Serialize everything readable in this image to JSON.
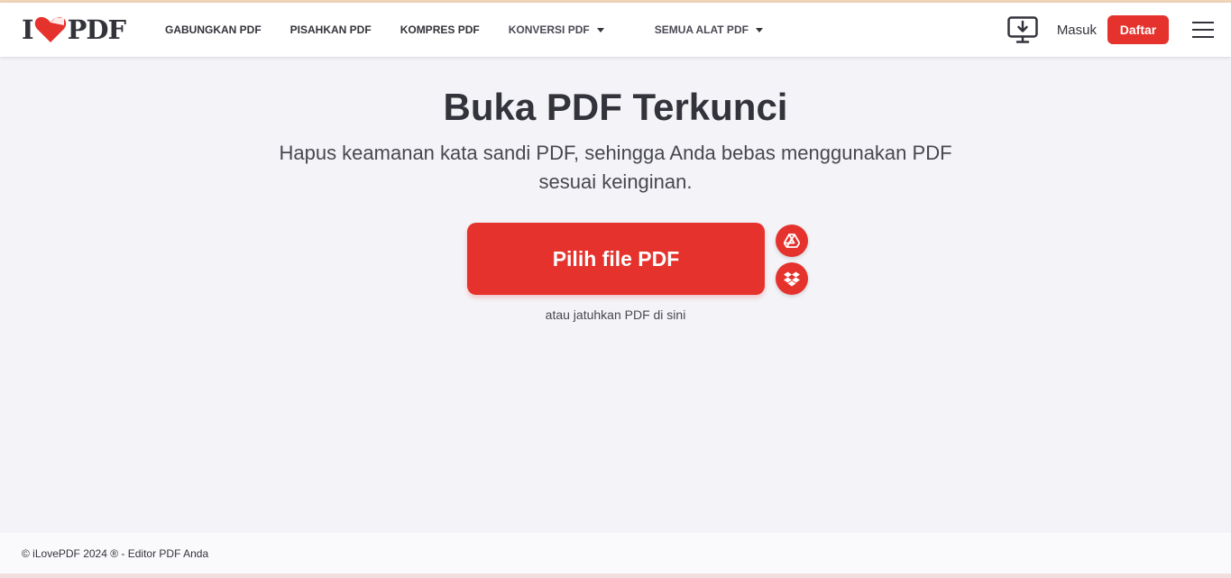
{
  "brand": {
    "logo_left": "I",
    "logo_right": "PDF",
    "accent": "#e5322d",
    "dark": "#33333b"
  },
  "nav": {
    "items": [
      {
        "label": "GABUNGKAN PDF"
      },
      {
        "label": "PISAHKAN PDF"
      },
      {
        "label": "KOMPRES PDF"
      },
      {
        "label": "KONVERSI PDF"
      },
      {
        "label": "SEMUA ALAT PDF"
      }
    ]
  },
  "header": {
    "desktop_icon": "desktop-download-icon",
    "login_label": "Masuk",
    "signup_label": "Daftar",
    "menu_icon": "hamburger-menu-icon"
  },
  "main": {
    "title": "Buka PDF Terkunci",
    "subtitle": "Hapus keamanan kata sandi PDF, sehingga Anda bebas menggunakan PDF sesuai keinginan.",
    "upload_label": "Pilih file PDF",
    "gdrive_icon": "google-drive-icon",
    "dropbox_icon": "dropbox-icon",
    "drop_hint": "atau jatuhkan PDF di sini"
  },
  "footer": {
    "copyright": "© iLovePDF 2024 ® - Editor PDF Anda"
  }
}
